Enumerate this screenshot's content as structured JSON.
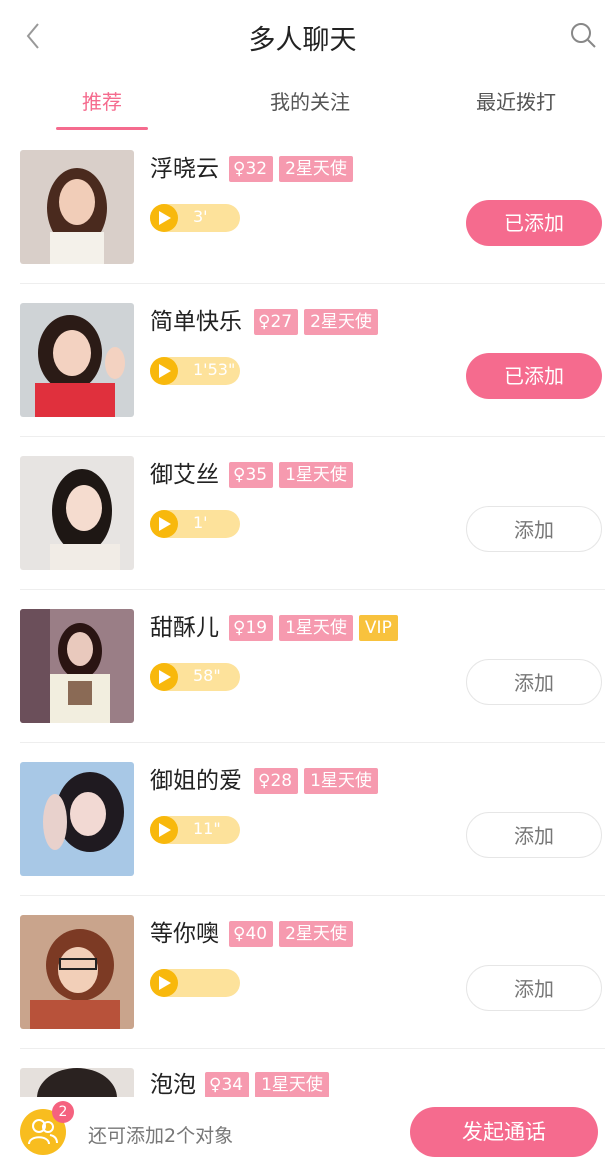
{
  "header": {
    "title": "多人聊天",
    "back_icon": "chevron-left-icon",
    "search_icon": "search-icon"
  },
  "tabs": [
    {
      "label": "推荐",
      "active": true
    },
    {
      "label": "我的关注",
      "active": false
    },
    {
      "label": "最近拨打",
      "active": false
    }
  ],
  "colors": {
    "accent": "#f56b8e",
    "badge": "#f69aaf",
    "vip": "#f8c23d",
    "voice": "#f8b80c"
  },
  "users": [
    {
      "name": "浮晓云",
      "age": "32",
      "level": "2星天使",
      "vip": "",
      "duration": "3'",
      "button": "已添加",
      "added": true
    },
    {
      "name": "简单快乐",
      "age": "27",
      "level": "2星天使",
      "vip": "",
      "duration": "1'53\"",
      "button": "已添加",
      "added": true
    },
    {
      "name": "御艾丝",
      "age": "35",
      "level": "1星天使",
      "vip": "",
      "duration": "1'",
      "button": "添加",
      "added": false
    },
    {
      "name": "甜酥儿",
      "age": "19",
      "level": "1星天使",
      "vip": "VIP",
      "duration": "58\"",
      "button": "添加",
      "added": false
    },
    {
      "name": "御姐的爱",
      "age": "28",
      "level": "1星天使",
      "vip": "",
      "duration": "11\"",
      "button": "添加",
      "added": false
    },
    {
      "name": "等你噢",
      "age": "40",
      "level": "2星天使",
      "vip": "",
      "duration": "",
      "button": "添加",
      "added": false
    },
    {
      "name": "泡泡",
      "age": "34",
      "level": "1星天使",
      "vip": "",
      "duration": "",
      "button": "",
      "added": false
    }
  ],
  "footer": {
    "count": "2",
    "hint": "还可添加2个对象",
    "call_label": "发起通话"
  }
}
